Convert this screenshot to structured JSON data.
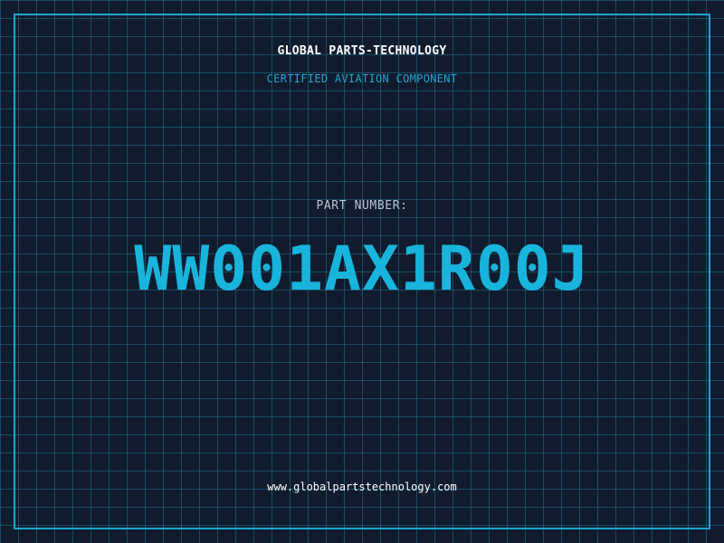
{
  "header": {
    "company_name": "GLOBAL PARTS-TECHNOLOGY",
    "subtitle": "CERTIFIED AVIATION COMPONENT"
  },
  "part": {
    "label": "PART NUMBER:",
    "number": "WW001AX1R00J"
  },
  "footer": {
    "website": "www.globalpartstechnology.com"
  },
  "colors": {
    "background": "#111b2e",
    "grid": "#1a748c",
    "accent": "#1fa5cf",
    "part_number": "#18b4dc",
    "label_text": "#b8c4d6",
    "primary_text": "#ffffff"
  }
}
